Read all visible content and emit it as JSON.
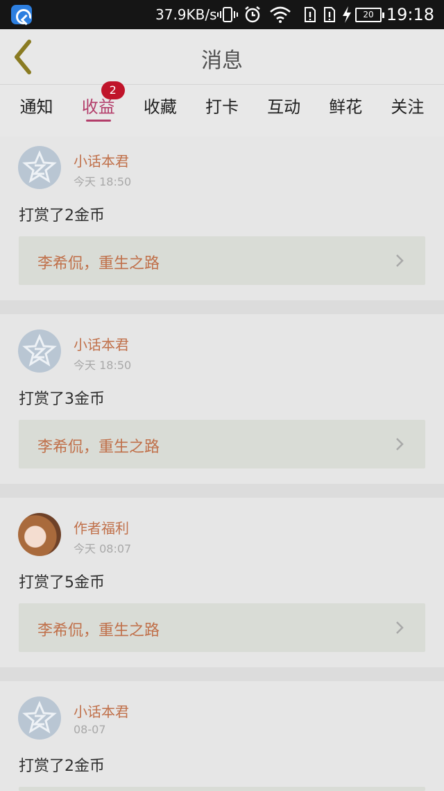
{
  "status_bar": {
    "speed": "37.9KB/s",
    "battery": "20",
    "time": "19:18",
    "icons": [
      "app-icon",
      "vibrate-icon",
      "alarm-icon",
      "wifi-icon",
      "sim1-icon",
      "sim2-icon",
      "charging-icon",
      "battery-icon"
    ]
  },
  "header": {
    "title": "消息",
    "back_icon": "chevron-left-icon",
    "accent": "#b33d6a"
  },
  "tabs": [
    {
      "label": "通知"
    },
    {
      "label": "收益",
      "badge": "2",
      "active": true
    },
    {
      "label": "收藏"
    },
    {
      "label": "打卡"
    },
    {
      "label": "互动"
    },
    {
      "label": "鲜花"
    },
    {
      "label": "关注"
    }
  ],
  "messages": [
    {
      "author": "小话本君",
      "time": "今天 18:50",
      "text": "打赏了2金币",
      "book": "李希侃，重生之路",
      "avatar": "default-avatar-icon"
    },
    {
      "author": "小话本君",
      "time": "今天 18:50",
      "text": "打赏了3金币",
      "book": "李希侃，重生之路",
      "avatar": "default-avatar-icon"
    },
    {
      "author": "作者福利",
      "time": "今天 08:07",
      "text": "打赏了5金币",
      "book": "李希侃，重生之路",
      "avatar": "anime-girl-avatar"
    },
    {
      "author": "小话本君",
      "time": "08-07",
      "text": "打赏了2金币",
      "book": "",
      "avatar": "default-avatar-icon"
    }
  ],
  "colors": {
    "name": "#c0704a",
    "badge": "#c0142a"
  }
}
